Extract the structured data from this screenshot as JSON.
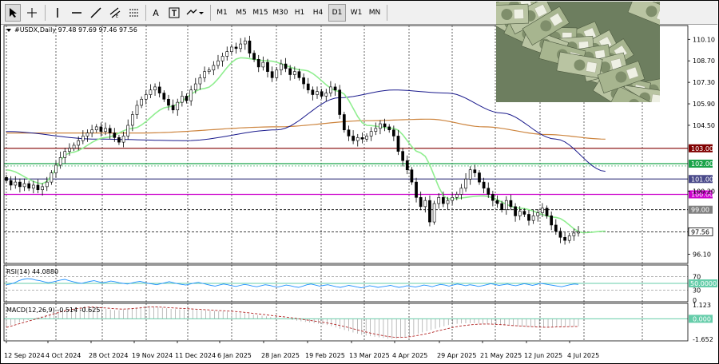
{
  "toolbar": {
    "timeframes": [
      "M1",
      "M5",
      "M15",
      "M30",
      "H1",
      "H4",
      "D1",
      "W1",
      "MN"
    ],
    "active_timeframe": "D1",
    "text_tool_label": "A"
  },
  "chart_data": {
    "type": "candlestick",
    "symbol_info": "#USDX,Daily  97.48 97.69 97.46 97.56",
    "ylim": [
      95.5,
      111.0
    ],
    "price_ticks": [
      110.1,
      108.7,
      107.3,
      105.9,
      104.5,
      103.0,
      102.0,
      101.0,
      100.2,
      99.0,
      97.56,
      96.1
    ],
    "x_labels": [
      "12 Sep 2024",
      "4 Oct 2024",
      "28 Oct 2024",
      "19 Nov 2024",
      "11 Dec 2024",
      "6 Jan 2025",
      "28 Jan 2025",
      "19 Feb 2025",
      "13 Mar 2025",
      "4 Apr 2025",
      "29 Apr 2025",
      "21 May 2025",
      "12 Jun 2025",
      "4 Jul 2025"
    ],
    "ohlc_close": [
      100.9,
      100.6,
      100.8,
      100.5,
      100.7,
      100.4,
      100.6,
      100.3,
      100.5,
      100.8,
      101.4,
      101.9,
      102.4,
      102.8,
      103.0,
      103.2,
      103.5,
      103.8,
      104.0,
      104.2,
      104.4,
      104.1,
      104.3,
      104.0,
      103.7,
      103.4,
      103.8,
      104.5,
      105.2,
      105.8,
      106.2,
      106.5,
      106.8,
      107.0,
      106.6,
      106.2,
      105.8,
      105.5,
      106.0,
      106.4,
      106.1,
      106.8,
      107.2,
      107.6,
      108.0,
      108.1,
      108.4,
      108.7,
      109.0,
      109.3,
      109.6,
      109.5,
      109.8,
      110.0,
      109.2,
      108.8,
      108.3,
      108.6,
      108.0,
      107.6,
      108.1,
      108.5,
      108.2,
      107.8,
      108.0,
      107.6,
      107.2,
      106.8,
      106.5,
      106.7,
      106.4,
      106.6,
      107.0,
      106.8,
      105.2,
      104.2,
      103.8,
      103.5,
      103.7,
      103.6,
      103.8,
      104.1,
      104.3,
      104.6,
      104.4,
      104.2,
      103.8,
      102.8,
      102.2,
      101.6,
      100.8,
      99.8,
      99.2,
      99.6,
      98.2,
      99.4,
      99.8,
      99.4,
      99.6,
      99.8,
      100.0,
      100.4,
      101.0,
      101.6,
      101.4,
      100.8,
      100.4,
      100.0,
      99.6,
      99.4,
      99.0,
      99.6,
      99.2,
      98.6,
      98.9,
      98.7,
      98.3,
      98.6,
      98.8,
      99.1,
      98.6,
      98.0,
      97.6,
      97.2,
      97.0,
      97.3,
      97.48,
      97.56
    ],
    "ma_fast_anchors": [
      [
        0,
        101.6
      ],
      [
        8,
        100.7
      ],
      [
        14,
        102.7
      ],
      [
        22,
        103.7
      ],
      [
        28,
        104.3
      ],
      [
        36,
        105.7
      ],
      [
        44,
        106.9
      ],
      [
        52,
        108.9
      ],
      [
        58,
        108.7
      ],
      [
        66,
        108.1
      ],
      [
        74,
        106.7
      ],
      [
        80,
        104.5
      ],
      [
        86,
        104.3
      ],
      [
        92,
        102.7
      ],
      [
        98,
        99.7
      ],
      [
        106,
        99.9
      ],
      [
        114,
        99.1
      ],
      [
        122,
        98.5
      ],
      [
        128,
        97.5
      ],
      [
        133,
        97.6
      ]
    ],
    "ma_mid_anchors": [
      [
        0,
        104.1
      ],
      [
        20,
        103.6
      ],
      [
        40,
        103.5
      ],
      [
        60,
        104.2
      ],
      [
        74,
        106.3
      ],
      [
        86,
        106.8
      ],
      [
        98,
        106.6
      ],
      [
        110,
        105.3
      ],
      [
        122,
        103.6
      ],
      [
        133,
        101.5
      ]
    ],
    "ma_slow_anchors": [
      [
        0,
        104.0
      ],
      [
        30,
        104.0
      ],
      [
        60,
        104.4
      ],
      [
        80,
        104.8
      ],
      [
        94,
        104.9
      ],
      [
        106,
        104.4
      ],
      [
        120,
        103.9
      ],
      [
        133,
        103.6
      ]
    ],
    "levels": [
      {
        "label": "103.00",
        "value": 103.0,
        "color": "#800000"
      },
      {
        "label": "102.00",
        "value": 102.0,
        "color": "#1aa34a"
      },
      {
        "label": "101.00",
        "value": 101.0,
        "color": "#4a4a8a"
      },
      {
        "label": "100.00",
        "value": 100.0,
        "color": "#cc00cc"
      },
      {
        "label": "99.00",
        "value": 99.0,
        "color": "#000000"
      },
      {
        "label": "97.56",
        "value": 97.56,
        "color": "#000000"
      }
    ],
    "rsi": {
      "label": "RSI(14) 44.0880",
      "ticks": [
        {
          "label": "70",
          "value": 70
        },
        {
          "label": "50",
          "value": 50
        },
        {
          "label": "30",
          "value": 30
        },
        {
          "label": "0",
          "value": 0
        }
      ],
      "current_label": "50.0000",
      "current_value": 50,
      "values": [
        46,
        48,
        52,
        58,
        62,
        64,
        63,
        60,
        58,
        55,
        52,
        54,
        57,
        60,
        62,
        58,
        55,
        52,
        50,
        53,
        56,
        58,
        55,
        52,
        54,
        57,
        55,
        52,
        50,
        48,
        51,
        54,
        56,
        53,
        50,
        48,
        46,
        49,
        52,
        55,
        52,
        49,
        47,
        45,
        48,
        51,
        53,
        50,
        47,
        44,
        42,
        45,
        48,
        46,
        43,
        41,
        44,
        47,
        45,
        42,
        40,
        43,
        46,
        44,
        41,
        39,
        42,
        45,
        43,
        40,
        38,
        42,
        46,
        48,
        45,
        42,
        44,
        46,
        43,
        40,
        38,
        41,
        44,
        42,
        39,
        37,
        40,
        43,
        41,
        38,
        40,
        42,
        44,
        41,
        38,
        40,
        43,
        41,
        39,
        42,
        45,
        43,
        40,
        44,
        47,
        45,
        42,
        45,
        48,
        46,
        43,
        46,
        44,
        41,
        43,
        46,
        49,
        47,
        44,
        46,
        48,
        45,
        43,
        46,
        49,
        47,
        44,
        47,
        50,
        48,
        46,
        44,
        42,
        40,
        43,
        46,
        48,
        47
      ]
    },
    "macd": {
      "label": "MACD(12,26,9) -0.514 -0.625",
      "ticks": [
        {
          "label": "1.123",
          "value": 1.123
        },
        {
          "label": "-1.652",
          "value": -1.652
        }
      ],
      "zero_label": "0.000",
      "hist": [
        -0.6,
        -0.5,
        -0.4,
        -0.3,
        -0.2,
        -0.1,
        0.0,
        0.1,
        0.2,
        0.3,
        0.4,
        0.5,
        0.6,
        0.7,
        0.8,
        0.85,
        0.9,
        0.95,
        1.0,
        1.0,
        0.95,
        0.9,
        0.85,
        0.8,
        0.75,
        0.7,
        0.7,
        0.75,
        0.8,
        0.85,
        0.9,
        0.95,
        1.0,
        1.05,
        1.0,
        0.95,
        0.9,
        0.85,
        0.8,
        0.78,
        0.76,
        0.75,
        0.74,
        0.73,
        0.72,
        0.7,
        0.68,
        0.66,
        0.64,
        0.62,
        0.6,
        0.58,
        0.55,
        0.52,
        0.5,
        0.45,
        0.4,
        0.35,
        0.3,
        0.25,
        0.2,
        0.15,
        0.1,
        0.05,
        0.0,
        -0.05,
        -0.1,
        -0.15,
        -0.2,
        -0.25,
        -0.3,
        -0.35,
        -0.4,
        -0.45,
        -0.5,
        -0.6,
        -0.7,
        -0.8,
        -0.9,
        -1.0,
        -1.1,
        -1.2,
        -1.3,
        -1.35,
        -1.4,
        -1.45,
        -1.5,
        -1.55,
        -1.6,
        -1.62,
        -1.6,
        -1.55,
        -1.5,
        -1.4,
        -1.3,
        -1.2,
        -1.1,
        -1.0,
        -0.9,
        -0.8,
        -0.7,
        -0.6,
        -0.5,
        -0.45,
        -0.4,
        -0.38,
        -0.36,
        -0.35,
        -0.36,
        -0.38,
        -0.4,
        -0.42,
        -0.45,
        -0.48,
        -0.5,
        -0.52,
        -0.55,
        -0.58,
        -0.6,
        -0.62,
        -0.64,
        -0.66,
        -0.68,
        -0.7,
        -0.72,
        -0.7,
        -0.68,
        -0.66,
        -0.65,
        -0.64,
        -0.63,
        -0.62,
        -0.61
      ],
      "signal": [
        -0.7,
        -0.6,
        -0.5,
        -0.4,
        -0.3,
        -0.2,
        -0.1,
        0.0,
        0.1,
        0.2,
        0.3,
        0.4,
        0.5,
        0.6,
        0.7,
        0.75,
        0.8,
        0.85,
        0.9,
        0.95,
        0.95,
        0.92,
        0.9,
        0.88,
        0.85,
        0.82,
        0.8,
        0.78,
        0.8,
        0.82,
        0.85,
        0.88,
        0.92,
        0.95,
        0.97,
        0.96,
        0.94,
        0.92,
        0.9,
        0.88,
        0.86,
        0.84,
        0.82,
        0.8,
        0.78,
        0.76,
        0.74,
        0.72,
        0.7,
        0.68,
        0.66,
        0.64,
        0.62,
        0.6,
        0.57,
        0.54,
        0.5,
        0.46,
        0.42,
        0.38,
        0.34,
        0.3,
        0.26,
        0.22,
        0.18,
        0.14,
        0.1,
        0.05,
        0.0,
        -0.05,
        -0.1,
        -0.15,
        -0.2,
        -0.25,
        -0.3,
        -0.36,
        -0.42,
        -0.5,
        -0.58,
        -0.66,
        -0.75,
        -0.84,
        -0.93,
        -1.02,
        -1.1,
        -1.18,
        -1.25,
        -1.32,
        -1.38,
        -1.44,
        -1.48,
        -1.5,
        -1.5,
        -1.48,
        -1.44,
        -1.38,
        -1.32,
        -1.25,
        -1.18,
        -1.1,
        -1.0,
        -0.92,
        -0.84,
        -0.76,
        -0.68,
        -0.62,
        -0.56,
        -0.52,
        -0.48,
        -0.45,
        -0.43,
        -0.42,
        -0.42,
        -0.43,
        -0.45,
        -0.47,
        -0.49,
        -0.52,
        -0.55,
        -0.57,
        -0.59,
        -0.61,
        -0.63,
        -0.65,
        -0.67,
        -0.68,
        -0.68,
        -0.67,
        -0.66,
        -0.65,
        -0.64,
        -0.63,
        -0.62,
        -0.625
      ]
    }
  },
  "colors": {
    "candle": "#000000",
    "ma_fast": "#90ee90",
    "ma_mid": "#1a1a8c",
    "ma_slow": "#cd853f",
    "rsi_line": "#1e90ff",
    "rsi_level": "#66cdaa",
    "macd_signal": "#b22222",
    "macd_zero": "#66cdaa",
    "grid": "#000000"
  }
}
